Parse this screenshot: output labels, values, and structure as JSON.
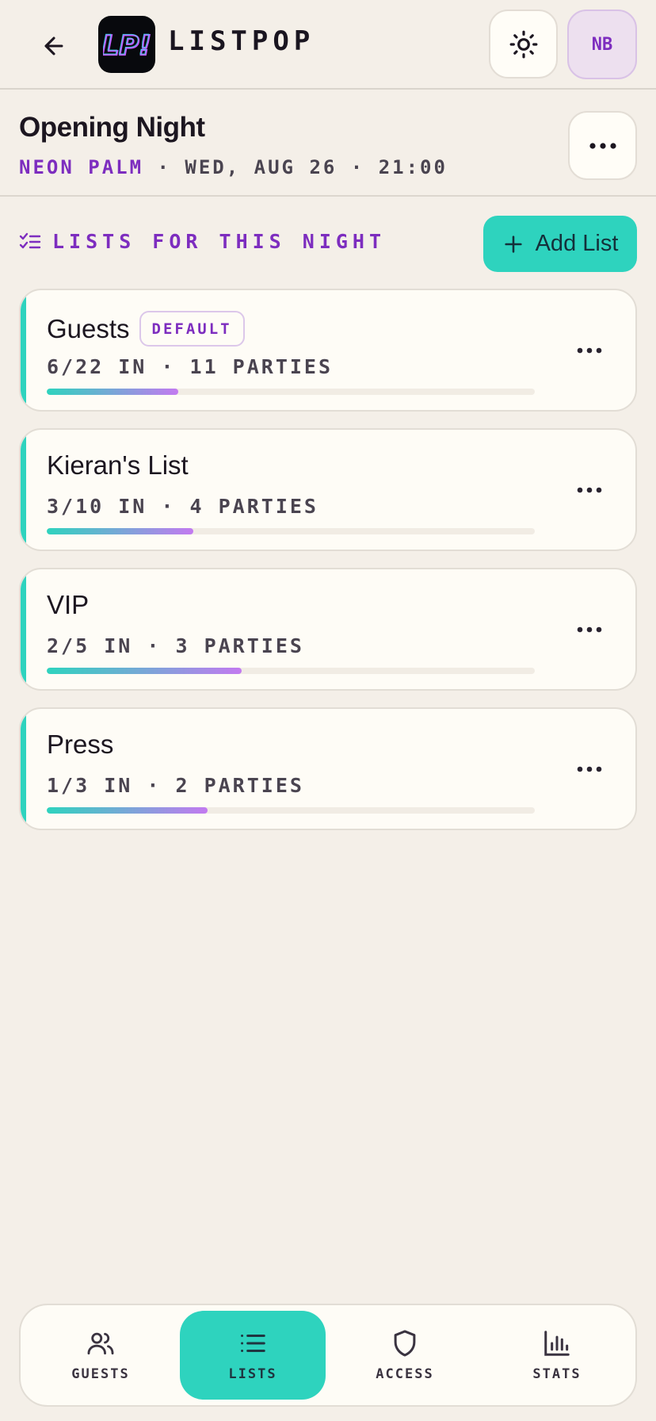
{
  "app": {
    "name": "LISTPOP",
    "logo_text": "LP!",
    "avatar_initials": "NB"
  },
  "event": {
    "title": "Opening Night",
    "venue": "NEON PALM",
    "datetime": "· WED, AUG 26 · 21:00"
  },
  "section": {
    "title": "LISTS FOR THIS NIGHT",
    "add_button_label": "Add List"
  },
  "lists": [
    {
      "name": "Guests",
      "badge": "DEFAULT",
      "stats": "6/22 IN · 11 PARTIES",
      "progress": 0.27
    },
    {
      "name": "Kieran's List",
      "badge": "",
      "stats": "3/10 IN · 4 PARTIES",
      "progress": 0.3
    },
    {
      "name": "VIP",
      "badge": "",
      "stats": "2/5 IN · 3 PARTIES",
      "progress": 0.4
    },
    {
      "name": "Press",
      "badge": "",
      "stats": "1/3 IN · 2 PARTIES",
      "progress": 0.33
    }
  ],
  "nav": {
    "items": [
      {
        "label": "GUESTS",
        "icon": "users-icon",
        "active": false
      },
      {
        "label": "LISTS",
        "icon": "list-icon",
        "active": true
      },
      {
        "label": "ACCESS",
        "icon": "shield-icon",
        "active": false
      },
      {
        "label": "STATS",
        "icon": "bar-chart-icon",
        "active": false
      }
    ]
  },
  "colors": {
    "accent_teal": "#2ed3be",
    "accent_purple": "#7d2dbf",
    "background": "#f4efe8",
    "card": "#fefcf6"
  }
}
